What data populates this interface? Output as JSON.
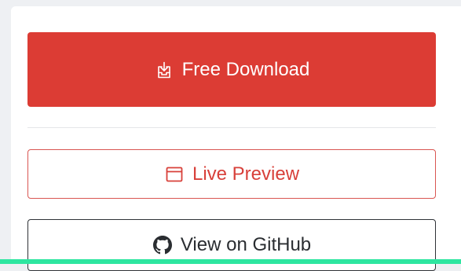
{
  "actions": {
    "download": {
      "label": "Free Download",
      "icon": "download-icon",
      "color": "#dc3c34"
    },
    "preview": {
      "label": "Live Preview",
      "icon": "browser-window-icon",
      "color": "#d8403a"
    },
    "github": {
      "label": "View on GitHub",
      "icon": "github-icon",
      "color": "#2a2d31"
    }
  },
  "colors": {
    "accent_bar": "#2ee6a0",
    "background": "#eef0f3",
    "card": "#ffffff"
  }
}
